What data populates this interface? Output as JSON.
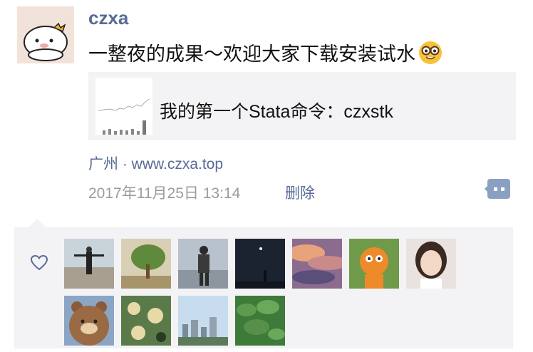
{
  "post": {
    "author": "czxa",
    "text": "一整夜的成果～欢迎大家下载安装试水",
    "emoji_icon": "nerd-face-emoji",
    "link_title": "我的第一个Stata命令：czxstk",
    "location": "广州 · www.czxa.top",
    "timestamp": "2017年11月25日 13:14",
    "delete_label": "删除"
  },
  "likes": {
    "icon": "heart-outline-icon",
    "avatars": [
      {
        "name": "liker-avatar-1",
        "bg": "#c9d3da"
      },
      {
        "name": "liker-avatar-2",
        "bg": "#d9cfb4"
      },
      {
        "name": "liker-avatar-3",
        "bg": "#b8c2cc"
      },
      {
        "name": "liker-avatar-4",
        "bg": "#1b2330"
      },
      {
        "name": "liker-avatar-5",
        "bg": "#8c6c8e"
      },
      {
        "name": "liker-avatar-6",
        "bg": "#6f9a4a"
      },
      {
        "name": "liker-avatar-7",
        "bg": "#e9e2df"
      },
      {
        "name": "liker-avatar-8",
        "bg": "#8ba6c4"
      },
      {
        "name": "liker-avatar-9",
        "bg": "#5b7a4a"
      },
      {
        "name": "liker-avatar-10",
        "bg": "#c7ddef"
      },
      {
        "name": "liker-avatar-11",
        "bg": "#3e7a3a"
      }
    ]
  },
  "colors": {
    "link_blue": "#576b95",
    "panel_gray": "#f3f3f5",
    "meta_gray": "#9b9b9b"
  }
}
